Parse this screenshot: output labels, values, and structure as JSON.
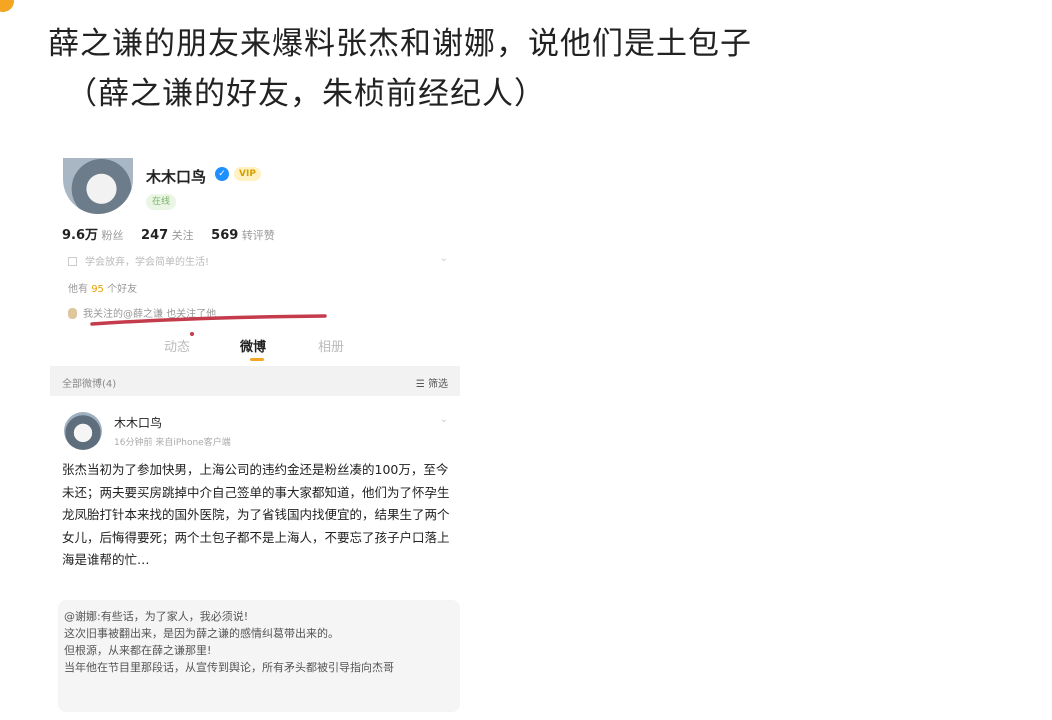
{
  "post": {
    "title_line1": "薛之谦的朋友来爆料张杰和谢娜，说他们是土包子",
    "title_line2": "（薛之谦的好友，朱桢前经纪人）"
  },
  "profile": {
    "name": "木木口鸟",
    "vip_label": "VIP",
    "online_label": "在线",
    "stats": [
      {
        "value": "9.6万",
        "label": "粉丝"
      },
      {
        "value": "247",
        "label": "关注"
      },
      {
        "value": "569",
        "label": "转评赞"
      }
    ],
    "bio": "学会放弃，学会简单的生活!",
    "friends_prefix": "他有",
    "friends_count": "95",
    "friends_suffix": "个好友",
    "mutual_follow": "我关注的@薛之谦 也关注了他"
  },
  "tabs": [
    {
      "label": "动态"
    },
    {
      "label": "微博"
    },
    {
      "label": "相册"
    }
  ],
  "feed": {
    "count_label": "全部微博(4)",
    "filter_label": "筛选"
  },
  "weibo_post": {
    "author": "木木口鸟",
    "meta": "16分钟前 来自iPhone客户端",
    "body": "张杰当初为了参加快男，上海公司的违约金还是粉丝凑的100万，至今未还；两夫要买房跳掉中介自己签单的事大家都知道，他们为了怀孕生龙凤胎打针本来找的国外医院，为了省钱国内找便宜的，结果生了两个女儿，后悔得要死；两个土包子都不是上海人，不要忘了孩子户口落上海是谁帮的忙…",
    "quote_lines": [
      "@谢娜:有些话，为了家人，我必须说!",
      "这次旧事被翻出来，是因为薛之谦的感情纠葛带出来的。",
      "但根源，从来都在薛之谦那里!",
      "当年他在节目里那段话，从宣传到舆论，所有矛头都被引导指向杰哥"
    ]
  },
  "colors": {
    "accent": "#f6a623",
    "verify": "#1e90ff",
    "annotation": "#c43b4c"
  }
}
